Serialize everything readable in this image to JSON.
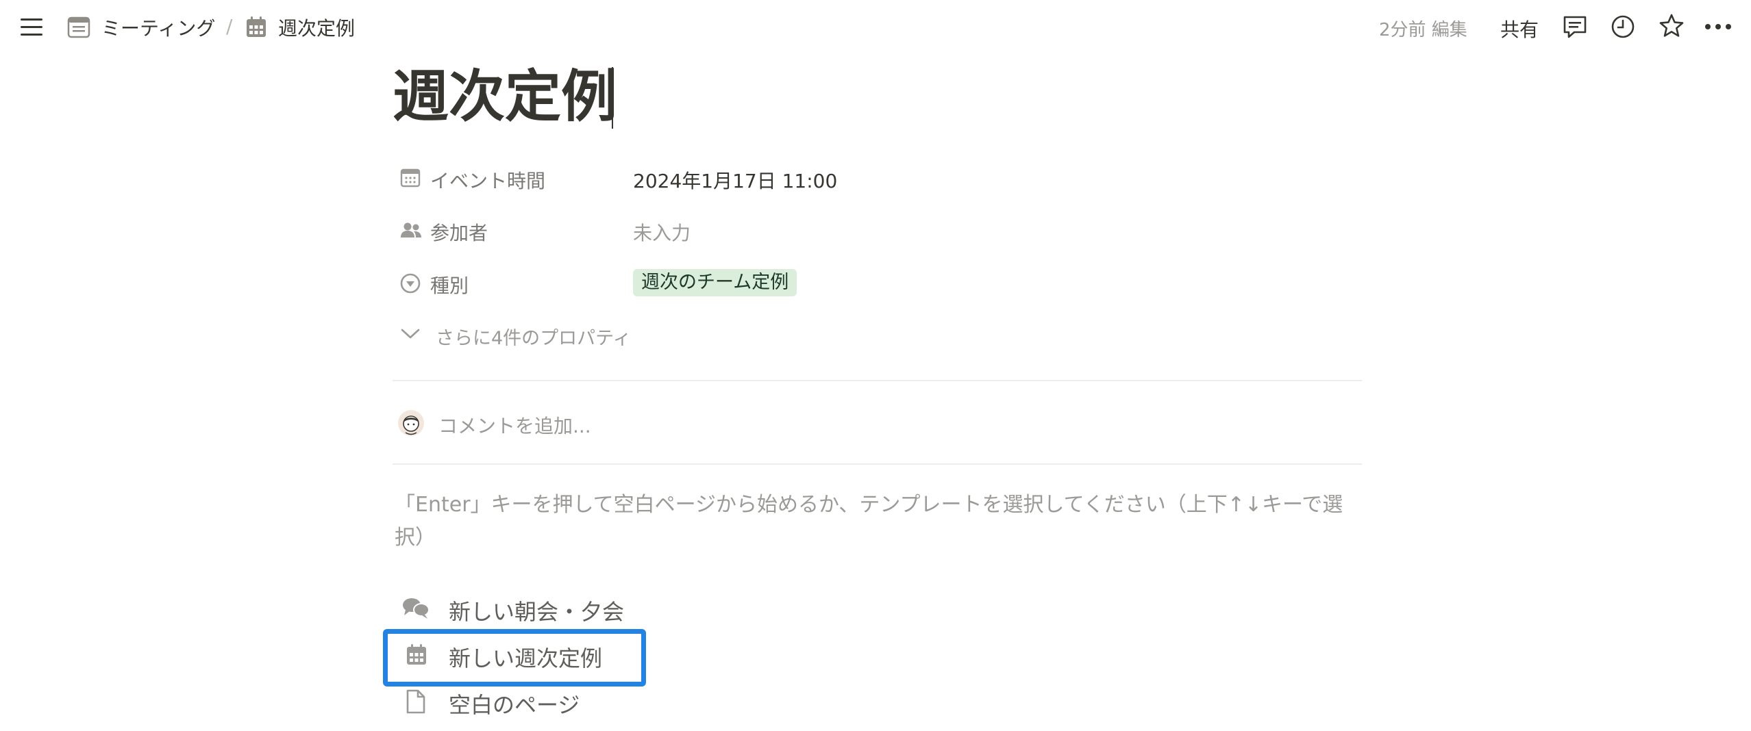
{
  "topbar": {
    "breadcrumb": [
      {
        "label": "ミーティング",
        "icon": "database-page-icon"
      },
      {
        "label": "週次定例",
        "icon": "calendar-icon"
      }
    ],
    "separator": "/",
    "edited": "2分前 編集",
    "share_label": "共有"
  },
  "page": {
    "title": "週次定例"
  },
  "properties": [
    {
      "label": "イベント時間",
      "icon": "calendar-icon",
      "value": "2024年1月17日 11:00"
    },
    {
      "label": "参加者",
      "icon": "people-icon",
      "value": "未入力"
    },
    {
      "label": "種別",
      "icon": "select-icon",
      "value": "週次のチーム定例",
      "tag_color": "#dbeddb"
    }
  ],
  "more_properties": "さらに4件のプロパティ",
  "comment": {
    "placeholder": "コメントを追加..."
  },
  "template_hint": "「Enter」キーを押して空白ページから始めるか、テンプレートを選択してください（上下↑↓キーで選択）",
  "templates": [
    {
      "label": "新しい朝会・夕会",
      "icon": "chat-bubbles-icon"
    },
    {
      "label": "新しい週次定例",
      "icon": "calendar-icon",
      "highlighted": true
    },
    {
      "label": "空白のページ",
      "icon": "document-icon"
    }
  ],
  "colors": {
    "accent": "#2383e2",
    "tag_green": "#dbeddb",
    "text": "#37352f",
    "muted": "#9b9a97"
  }
}
